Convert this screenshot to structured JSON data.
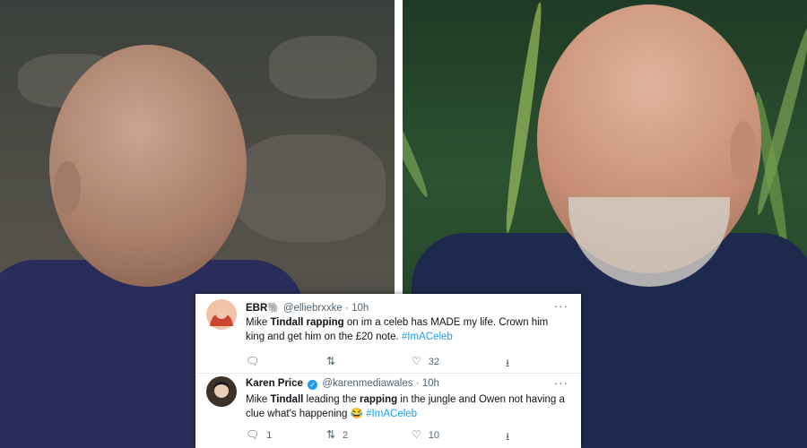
{
  "tweets": [
    {
      "name": "EBR🐘",
      "handle": "@elliebrxxke",
      "time": "10h",
      "text_before": "Mike ",
      "bold1": "Tindall",
      "mid1": " ",
      "bold2": "rapping",
      "text_after": " on im a celeb has MADE my life. Crown him king and get him on the £20 note. ",
      "hashtag": "#ImACeleb",
      "replies": "",
      "retweets": "",
      "likes": "32",
      "avatar_color": "#d9583b",
      "verified": false
    },
    {
      "name": "Karen Price",
      "handle": "@karenmediawales",
      "time": "10h",
      "text_before": "Mike ",
      "bold1": "Tindall",
      "mid1": " leading the ",
      "bold2": "rapping",
      "text_after": " in the jungle and Owen not having a clue what's happening 😂 ",
      "hashtag": "#ImACeleb",
      "replies": "1",
      "retweets": "2",
      "likes": "10",
      "avatar_color": "#2b2622",
      "verified": true
    }
  ],
  "icons": {
    "reply": "reply-icon",
    "retweet": "retweet-icon",
    "like": "heart-icon",
    "share": "share-icon",
    "more": "more-icon",
    "verified": "verified-icon"
  },
  "colors": {
    "link": "#1d9bf0",
    "text": "#0f1419",
    "muted": "#536471"
  }
}
